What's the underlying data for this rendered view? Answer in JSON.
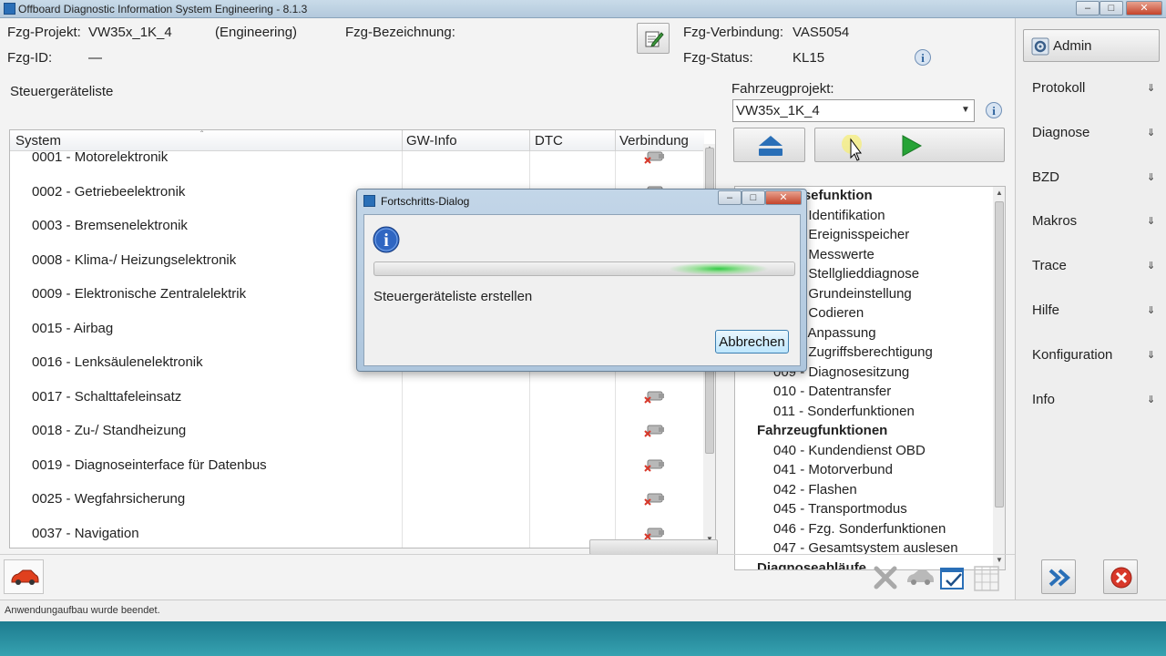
{
  "window": {
    "title": "Offboard Diagnostic Information System Engineering - 8.1.3"
  },
  "header": {
    "projekt_label": "Fzg-Projekt:",
    "projekt_value": "VW35x_1K_4",
    "mode": "(Engineering)",
    "bezeichnung_label": "Fzg-Bezeichnung:",
    "id_label": "Fzg-ID:",
    "id_value": "—",
    "verbindung_label": "Fzg-Verbindung:",
    "verbindung_value": "VAS5054",
    "status_label": "Fzg-Status:",
    "status_value": "KL15"
  },
  "list": {
    "title": "Steuergeräteliste",
    "columns": [
      "System",
      "GW-Info",
      "DTC",
      "Verbindung"
    ],
    "rows": [
      "0001 - Motorelektronik",
      "0002 - Getriebeelektronik",
      "0003 - Bremsenelektronik",
      "0008 - Klima-/ Heizungselektronik",
      "0009 - Elektronische Zentralelektrik",
      "0015 - Airbag",
      "0016 - Lenksäulenelektronik",
      "0017 - Schalttafeleinsatz",
      "0018 - Zu-/ Standheizung",
      "0019 - Diagnoseinterface für Datenbus",
      "0025 - Wegfahrsicherung",
      "0037 - Navigation"
    ]
  },
  "project": {
    "label": "Fahrzeugprojekt:",
    "selected": "VW35x_1K_4"
  },
  "tree": {
    "group1": "Diagnosefunktion",
    "group1_items": [
      "001 - Identifikation",
      "002 - Ereignisspeicher",
      "003 - Messwerte",
      "004 - Stellglieddiagnose",
      "005 - Grundeinstellung",
      "006 - Codieren",
      "007 - Anpassung",
      "008 - Zugriffsberechtigung",
      "009 - Diagnosesitzung",
      "010 - Datentransfer",
      "011 - Sonderfunktionen"
    ],
    "group2": "Fahrzeugfunktionen",
    "group2_items": [
      "040 - Kundendienst OBD",
      "041 - Motorverbund",
      "042 - Flashen",
      "045 - Transportmodus",
      "046 - Fzg. Sonderfunktionen",
      "047 - Gesamtsystem auslesen"
    ],
    "group3": "Diagnoseabläufe"
  },
  "sidebar": {
    "admin": "Admin",
    "items": [
      "Protokoll",
      "Diagnose",
      "BZD",
      "Makros",
      "Trace",
      "Hilfe",
      "Konfiguration",
      "Info"
    ]
  },
  "dialog": {
    "title": "Fortschritts-Dialog",
    "message": "Steuergeräteliste erstellen",
    "cancel": "Abbrechen",
    "progress": 0.82
  },
  "status": {
    "text": "Anwendungaufbau wurde beendet."
  },
  "colors": {
    "accent": "#2a6fb7",
    "close_red": "#d8382a",
    "progress_green": "#2ec63a"
  }
}
